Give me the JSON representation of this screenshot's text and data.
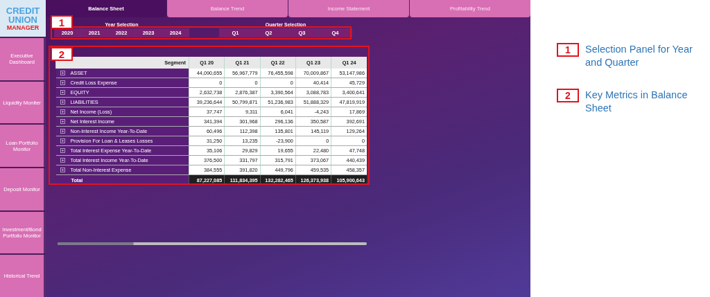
{
  "logo": {
    "line1": "CREDIT",
    "line2": "UNION",
    "line3": "MANAGER"
  },
  "sidebar": {
    "items": [
      {
        "label": "Executive Dashboard"
      },
      {
        "label": "Liquidity Moniter"
      },
      {
        "label": "Loan Portfolio Monitor"
      },
      {
        "label": "Deposit Monitor"
      },
      {
        "label": "Investment/Bond Portfolio Monitor"
      },
      {
        "label": "Historical Trend"
      }
    ]
  },
  "tabs": [
    {
      "label": "Balance Sheet",
      "selected": true
    },
    {
      "label": "Balance Trend",
      "selected": false
    },
    {
      "label": "Income Statement",
      "selected": false
    },
    {
      "label": "Profitability Trend",
      "selected": false
    }
  ],
  "year_selection": {
    "label": "Year Selection",
    "options": [
      {
        "label": "2020",
        "selected": false
      },
      {
        "label": "2021",
        "selected": false
      },
      {
        "label": "2022",
        "selected": false
      },
      {
        "label": "2023",
        "selected": false
      },
      {
        "label": "2024",
        "selected": false
      }
    ]
  },
  "quarter_selection": {
    "label": "Quarter Selection",
    "options": [
      {
        "label": "Q1",
        "selected": false
      },
      {
        "label": "Q2",
        "selected": false
      },
      {
        "label": "Q3",
        "selected": false
      },
      {
        "label": "Q4",
        "selected": false
      }
    ]
  },
  "table": {
    "columns": [
      "Segment",
      "Q1 20",
      "Q1 21",
      "Q1 22",
      "Q1 23",
      "Q1 24"
    ],
    "rows": [
      {
        "segment": "ASSET",
        "values": [
          "44,090,655",
          "56,967,779",
          "76,455,598",
          "70,009,867",
          "53,147,986"
        ]
      },
      {
        "segment": "Credit Loss Expense",
        "values": [
          "0",
          "0",
          "0",
          "40,414",
          "45,729"
        ]
      },
      {
        "segment": "EQUITY",
        "values": [
          "2,632,738",
          "2,876,387",
          "3,390,564",
          "3,088,783",
          "3,400,641"
        ]
      },
      {
        "segment": "LIABILITIES",
        "values": [
          "39,236,644",
          "50,799,871",
          "51,236,983",
          "51,888,329",
          "47,819,919"
        ]
      },
      {
        "segment": "Net Income (Loss)",
        "values": [
          "37,747",
          "9,311",
          "6,041",
          "-4,243",
          "17,869"
        ]
      },
      {
        "segment": "Net Interest Income",
        "values": [
          "341,394",
          "301,968",
          "296,136",
          "350,587",
          "392,691"
        ]
      },
      {
        "segment": "Non-Interest Income Year-To-Date",
        "values": [
          "60,496",
          "112,398",
          "135,801",
          "145,119",
          "129,264"
        ]
      },
      {
        "segment": "Provision For Loan & Leases Losses",
        "values": [
          "31,250",
          "13,235",
          "-23,900",
          "0",
          "0"
        ]
      },
      {
        "segment": "Total Interest Expense Year-To-Date",
        "values": [
          "35,106",
          "29,829",
          "19,655",
          "22,480",
          "47,748"
        ]
      },
      {
        "segment": "Total Interest Income Year-To-Date",
        "values": [
          "376,500",
          "331,797",
          "315,791",
          "373,067",
          "440,439"
        ]
      },
      {
        "segment": "Total Non-Interest Expense",
        "values": [
          "384,555",
          "391,820",
          "449,796",
          "459,535",
          "458,357"
        ]
      }
    ],
    "total": {
      "label": "Total",
      "values": [
        "87,227,085",
        "111,834,395",
        "132,282,465",
        "126,373,938",
        "105,900,643"
      ]
    }
  },
  "callouts": [
    {
      "number": "1"
    },
    {
      "number": "2"
    }
  ],
  "annotations": [
    {
      "number": "1",
      "text": "Selection Panel for Year and Quarter"
    },
    {
      "number": "2",
      "text": "Key Metrics in Balance Sheet"
    }
  ]
}
